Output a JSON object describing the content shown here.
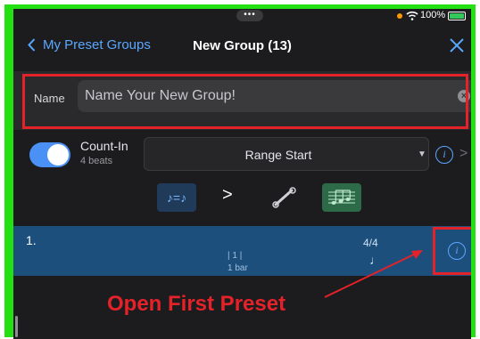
{
  "status_bar": {
    "dots": "•••",
    "battery_percent": "100%"
  },
  "navbar": {
    "back_label": "My Preset Groups",
    "title": "New Group (13)"
  },
  "name_field": {
    "label": "Name",
    "placeholder": "Name Your New Group!",
    "clear_glyph": "×"
  },
  "count_in": {
    "label": "Count-In",
    "sub": "4 beats",
    "enabled": true
  },
  "range": {
    "selected": "Range Start",
    "arrow": "▼"
  },
  "info_glyph": "i",
  "chevron_right": ">",
  "tools": {
    "notes_label": "♪=♪",
    "gt_label": ">"
  },
  "preset": {
    "index": "1.",
    "bar_number": "| 1 |",
    "bar_length": "1 bar",
    "time_signature": "4/4",
    "note": "♩"
  },
  "annotation": {
    "text": "Open First Preset"
  },
  "colors": {
    "accent": "#5aa7ff",
    "highlight": "#e3222a",
    "frame_green": "#22e012",
    "preset_row": "#1d4f7d"
  },
  "icons": [
    "wifi-icon",
    "battery-icon",
    "chevron-left-icon",
    "close-icon",
    "clear-icon",
    "info-icon",
    "chevron-right-icon",
    "wrench-icon",
    "staff-icon"
  ]
}
